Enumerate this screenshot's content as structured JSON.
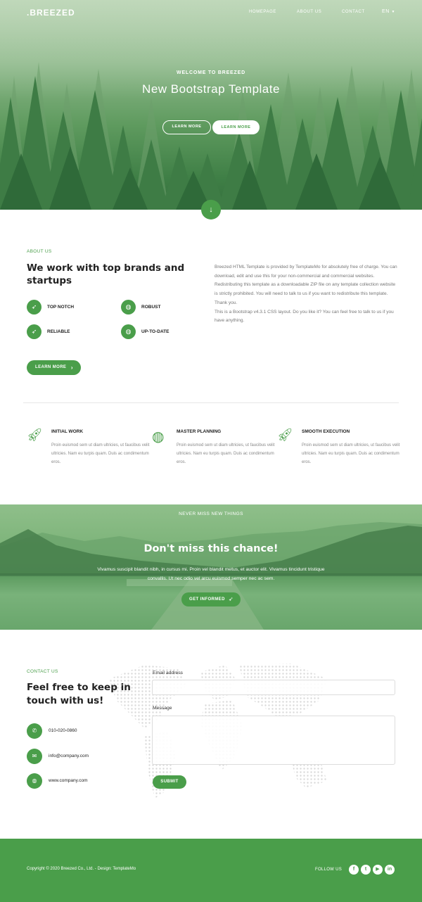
{
  "nav": {
    "brand": ".BREEZED",
    "links": [
      "HOMEPAGE",
      "ABOUT US",
      "CONTACT"
    ],
    "language": "EN"
  },
  "hero": {
    "kicker": "WELCOME TO BREEZED",
    "title": "New Bootstrap Template",
    "button_1": "LEARN MORE",
    "button_2": "LEARN MORE",
    "scroll_icon": "arrow-down-icon"
  },
  "about": {
    "kicker": "ABOUT US",
    "title": "We work with top brands and startups",
    "features": [
      {
        "label": "TOP NOTCH",
        "icon": "rocket-icon"
      },
      {
        "label": "ROBUST",
        "icon": "globe-icon"
      },
      {
        "label": "RELIABLE",
        "icon": "rocket-icon"
      },
      {
        "label": "UP-TO-DATE",
        "icon": "globe-icon"
      }
    ],
    "paragraphs": [
      "Breezed HTML Template is provided by TemplateMo for absolutely free of charge. You can download, edit and use this for your non-commercial and commercial websites.",
      "Redistributing this template as a downloadable ZIP file on any template collection website is strictly prohibited. You will need to talk to us if you want to redistribute this template. Thank you.",
      "This is a Bootstrap v4.3.1 CSS layout. Do you like it? You can feel free to talk to us if you have anything."
    ],
    "button": "LEARN MORE"
  },
  "services": [
    {
      "title": "INITIAL WORK",
      "text": "Proin euismod sem ut diam ultricies, ut faucibus velit ultricies. Nam eu turpis quam. Duis ac condimentum eros.",
      "icon": "rocket-icon"
    },
    {
      "title": "MASTER PLANNING",
      "text": "Proin euismod sem ut diam ultricies, ut faucibus velit ultricies. Nam eu turpis quam. Duis ac condimentum eros.",
      "icon": "globe-icon"
    },
    {
      "title": "SMOOTH EXECUTION",
      "text": "Proin euismod sem ut diam ultricies, ut faucibus velit ultricies. Nam eu turpis quam. Duis ac condimentum eros.",
      "icon": "rocket-icon"
    }
  ],
  "cta": {
    "kicker": "NEVER MISS NEW THINGS",
    "title": "Don't miss this chance!",
    "text": "Vivamus suscipit blandit nibh, in cursus mi. Proin vel blandit metus, et auctor elit. Vivamus tincidunt tristique convallis. Ut nec odio vel arcu euismod semper nec ac sem.",
    "button": "GET INFORMED",
    "button_icon": "rocket-icon"
  },
  "contact": {
    "kicker": "CONTACT US",
    "title": "Feel free to keep in touch with us!",
    "items": [
      {
        "label": "010-020-0860",
        "icon": "phone-icon"
      },
      {
        "label": "info@company.com",
        "icon": "mail-icon"
      },
      {
        "label": "www.company.com",
        "icon": "globe-icon"
      }
    ],
    "email_label": "Email address",
    "email_value": "",
    "message_label": "Message",
    "message_value": "",
    "submit": "SUBMIT"
  },
  "footer": {
    "copyright": "Copyright © 2020 Breezed Co., Ltd. - Design: TemplateMo",
    "follow": "FOLLOW US",
    "social": [
      "facebook-icon",
      "twitter-icon",
      "youtube-icon",
      "linkedin-icon"
    ]
  },
  "colors": {
    "accent": "#4a9e4a",
    "text_dark": "#222222",
    "text_muted": "#888888"
  }
}
